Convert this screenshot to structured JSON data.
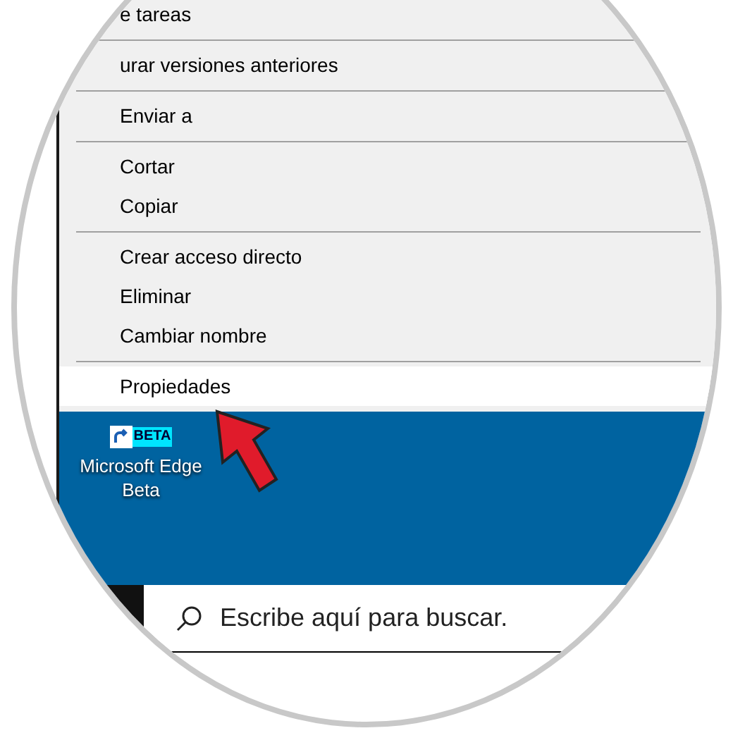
{
  "context_menu": {
    "items": [
      {
        "kind": "item",
        "label": "e tareas",
        "selected": false
      },
      {
        "kind": "separator"
      },
      {
        "kind": "item",
        "label": "urar versiones anteriores",
        "selected": false
      },
      {
        "kind": "separator"
      },
      {
        "kind": "item",
        "label": "Enviar a",
        "selected": false
      },
      {
        "kind": "separator"
      },
      {
        "kind": "item",
        "label": "Cortar",
        "selected": false
      },
      {
        "kind": "item",
        "label": "Copiar",
        "selected": false
      },
      {
        "kind": "separator"
      },
      {
        "kind": "item",
        "label": "Crear acceso directo",
        "selected": false
      },
      {
        "kind": "item",
        "label": "Eliminar",
        "selected": false
      },
      {
        "kind": "item",
        "label": "Cambiar nombre",
        "selected": false
      },
      {
        "kind": "separator"
      },
      {
        "kind": "item",
        "label": "Propiedades",
        "selected": true
      }
    ]
  },
  "desktop_icon": {
    "badge": "BETA",
    "label": "Microsoft Edge Beta"
  },
  "taskbar": {
    "search": {
      "placeholder": "Escribe aquí para buscar."
    }
  }
}
